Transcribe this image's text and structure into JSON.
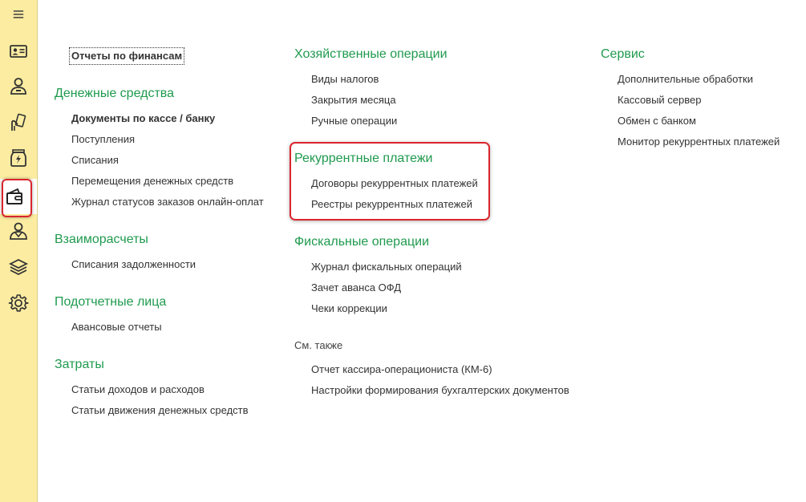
{
  "sidebar": {
    "items": [
      {
        "name": "menu-icon"
      },
      {
        "name": "id-card-icon"
      },
      {
        "name": "person-icon"
      },
      {
        "name": "hand-card-icon"
      },
      {
        "name": "money-jar-icon"
      },
      {
        "name": "wallet-icon"
      },
      {
        "name": "people-icon"
      },
      {
        "name": "layers-icon"
      },
      {
        "name": "gear-icon"
      }
    ]
  },
  "col1": {
    "top_link": "Отчеты по финансам",
    "money": {
      "title": "Денежные средства",
      "items": [
        "Документы по кассе / банку",
        "Поступления",
        "Списания",
        "Перемещения денежных средств",
        "Журнал статусов заказов онлайн-оплат"
      ]
    },
    "settlements": {
      "title": "Взаиморасчеты",
      "items": [
        "Списания задолженности"
      ]
    },
    "accountable": {
      "title": "Подотчетные лица",
      "items": [
        "Авансовые отчеты"
      ]
    },
    "costs": {
      "title": "Затраты",
      "items": [
        "Статьи доходов и расходов",
        "Статьи движения денежных средств"
      ]
    }
  },
  "col2": {
    "business": {
      "title": "Хозяйственные операции",
      "items": [
        "Виды налогов",
        "Закрытия месяца",
        "Ручные операции"
      ]
    },
    "recurring": {
      "title": "Рекуррентные платежи",
      "items": [
        "Договоры рекуррентных платежей",
        "Реестры рекуррентных платежей"
      ]
    },
    "fiscal": {
      "title": "Фискальные операции",
      "items": [
        "Журнал фискальных операций",
        "Зачет аванса ОФД",
        "Чеки коррекции"
      ]
    },
    "see_also": {
      "title": "См. также",
      "items": [
        "Отчет кассира-операциониста (КМ-6)",
        "Настройки формирования бухгалтерских документов"
      ]
    }
  },
  "col3": {
    "service": {
      "title": "Сервис",
      "items": [
        "Дополнительные обработки",
        "Кассовый сервер",
        "Обмен с банком",
        "Монитор рекуррентных платежей"
      ]
    }
  },
  "colors": {
    "header_green": "#1f9a4e",
    "sidebar_yellow": "#fbeca1",
    "highlight_red": "#d9262e"
  }
}
